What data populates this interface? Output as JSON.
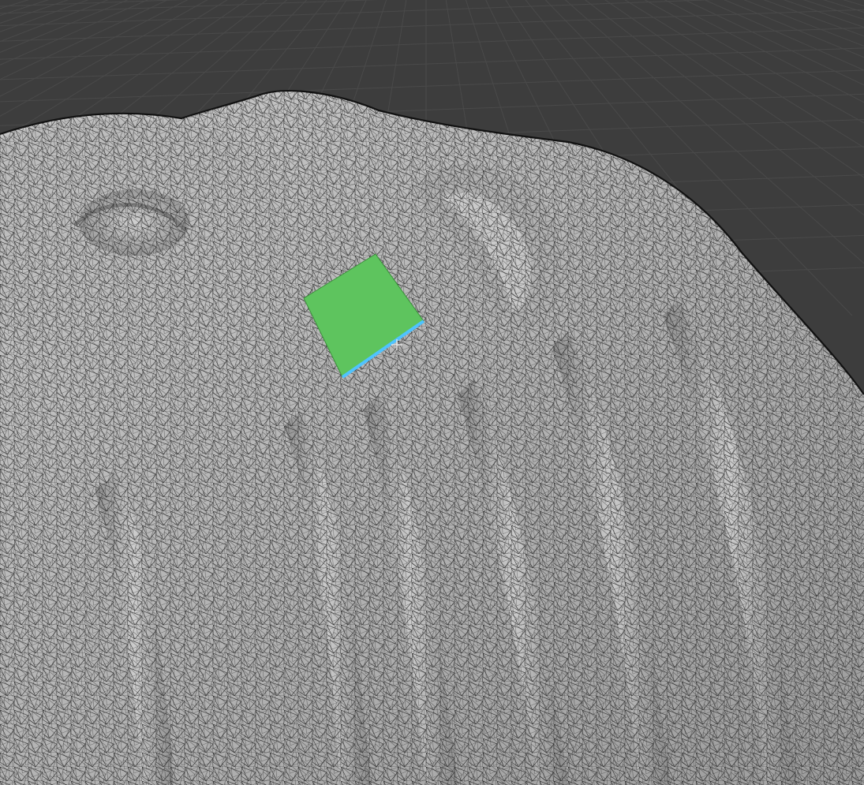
{
  "viewport": {
    "mode": "3d-viewport",
    "shading": "solid-with-wireframe-overlay",
    "background_color": "#3d3d3d",
    "grid_color": "#4a4a4a",
    "mesh_color": "#b9b9b9",
    "wire_color": "#1a1a1a",
    "selected_face_color": "#5ec45e",
    "active_edge_color": "#4fc3ff",
    "cursor": "3d-cursor-icon"
  },
  "object": {
    "name": "sculpted-mesh",
    "selection": {
      "type": "face",
      "count": 1
    }
  }
}
